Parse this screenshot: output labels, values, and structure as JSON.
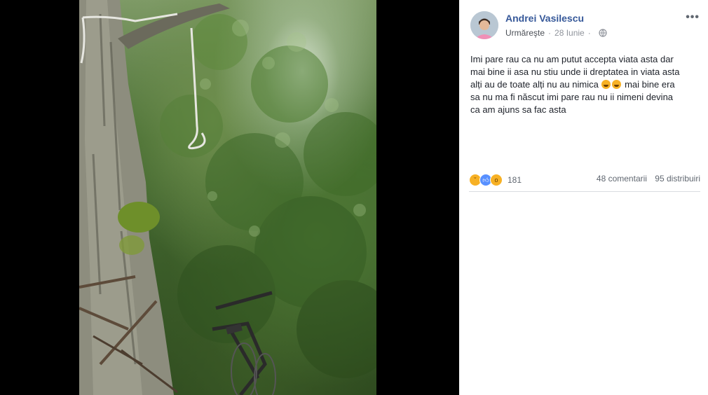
{
  "post": {
    "author": "Andrei Vasilescu",
    "follow_label": "Urmăreşte",
    "date": "28 Iunie",
    "privacy_icon": "globe-icon",
    "more_icon": "more-options-icon",
    "text_lines": [
      "Imi pare rau ca nu am putut accepta viata asta dar",
      "mai bine ii asa nu stiu unde ii dreptatea in viata asta",
      "alți au de toate alți nu au nimica",
      "mai bine era",
      "sa nu ma fi născut imi pare rau nu ii nimeni devina",
      "ca am ajuns sa fac asta"
    ]
  },
  "engagement": {
    "reaction_icons": [
      "sad-reaction-icon",
      "like-reaction-icon",
      "wow-reaction-icon"
    ],
    "reaction_count": "181",
    "comments": "48 comentarii",
    "shares": "95 distribuiri"
  },
  "colors": {
    "author_link": "#365899",
    "meta_text": "#90949c",
    "like_blue": "#5890ff",
    "reaction_yellow": "#f7b125"
  }
}
